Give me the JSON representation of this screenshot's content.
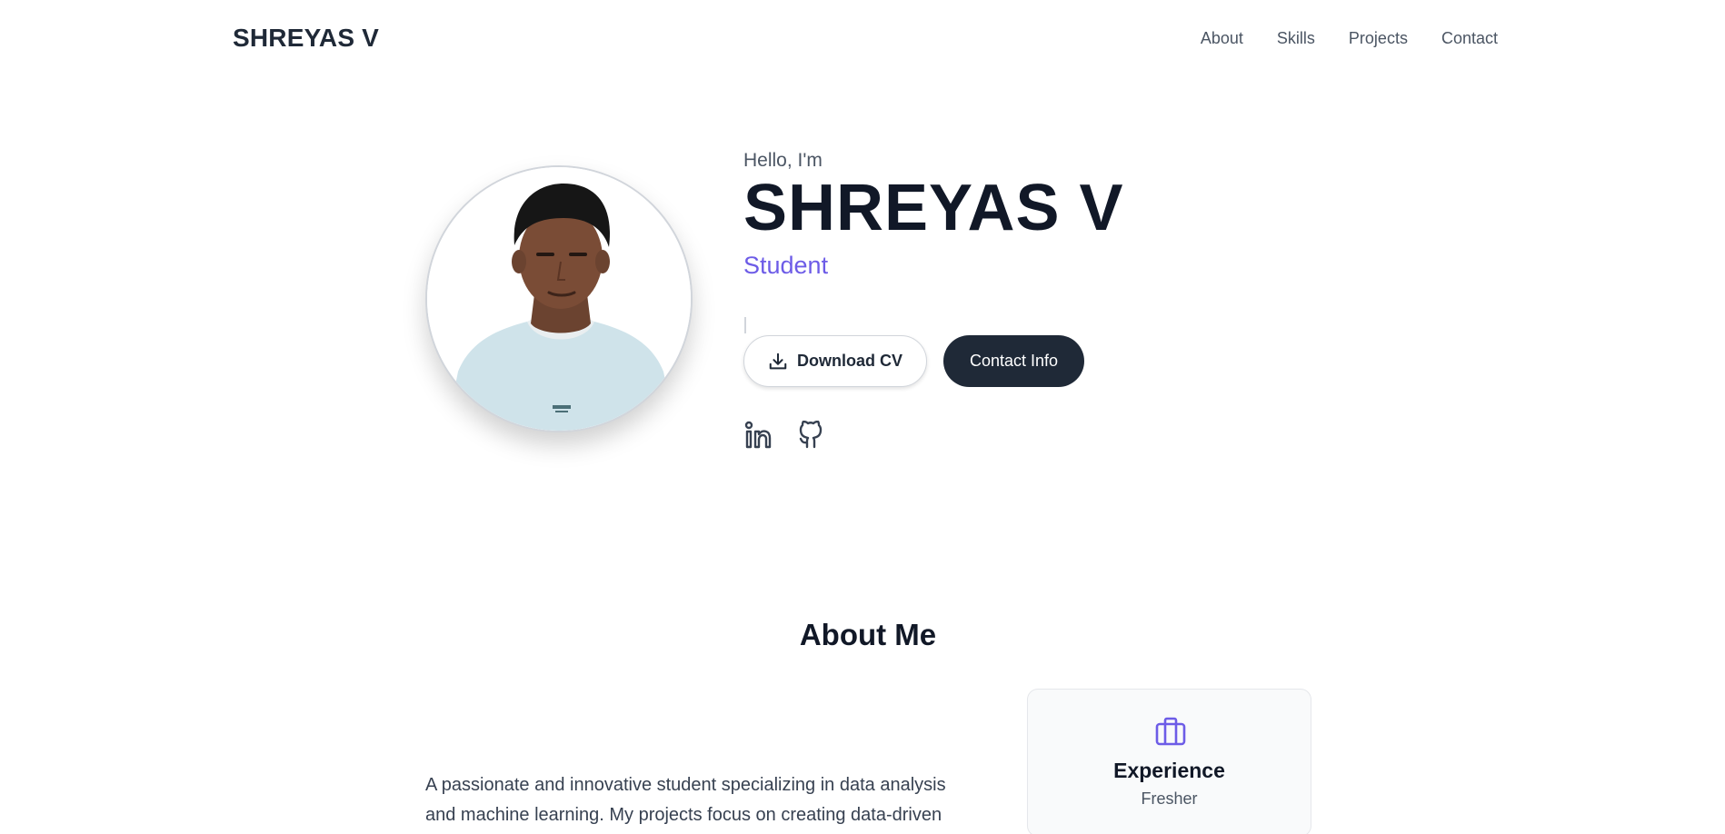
{
  "header": {
    "brand": "SHREYAS V",
    "nav": [
      "About",
      "Skills",
      "Projects",
      "Contact"
    ]
  },
  "hero": {
    "greeting": "Hello, I'm",
    "name": "SHREYAS V",
    "role": "Student",
    "download_label": "Download CV",
    "contact_label": "Contact Info",
    "socials": [
      "linkedin-icon",
      "github-icon"
    ],
    "accent_color": "#6d5ce7",
    "dark_button_color": "#1f2937"
  },
  "about": {
    "title": "About Me",
    "description": "A passionate and innovative student specializing in data analysis and machine learning. My projects focus on creating data-driven",
    "stat": {
      "icon": "briefcase-icon",
      "label": "Experience",
      "value": "Fresher"
    }
  }
}
